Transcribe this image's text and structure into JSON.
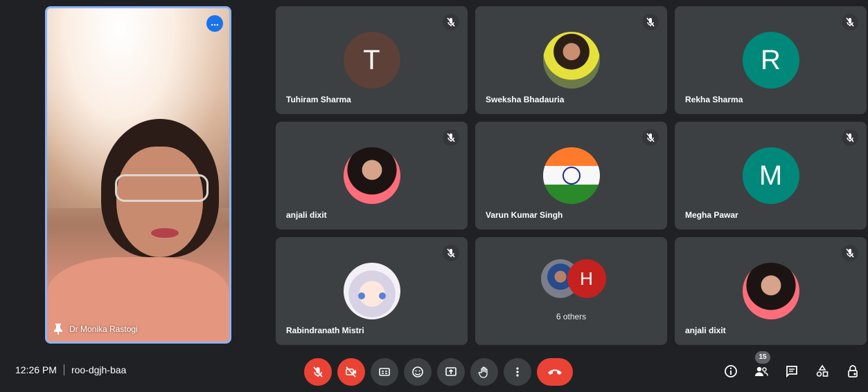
{
  "pinned": {
    "name": "Dr Monika Rastogi",
    "more_label": "..."
  },
  "tiles": [
    {
      "name": "Tuhiram Sharma",
      "avatar_letter": "T",
      "avatar_color": "#5d4037"
    },
    {
      "name": "Sweksha Bhadauria",
      "avatar_letter": "",
      "avatar_color": ""
    },
    {
      "name": "Rekha Sharma",
      "avatar_letter": "R",
      "avatar_color": "#00897b"
    },
    {
      "name": "anjali dixit",
      "avatar_letter": "",
      "avatar_color": ""
    },
    {
      "name": "Varun Kumar Singh",
      "avatar_letter": "",
      "avatar_color": ""
    },
    {
      "name": "Megha Pawar",
      "avatar_letter": "M",
      "avatar_color": "#00897b"
    },
    {
      "name": "Rabindranath Mistri",
      "avatar_letter": "",
      "avatar_color": ""
    },
    {
      "name": "anjali dixit",
      "avatar_letter": "",
      "avatar_color": ""
    }
  ],
  "others": {
    "label": "6 others",
    "avatar_letter": "H"
  },
  "meeting": {
    "time": "12:26 PM",
    "code": "roo-dgjh-baa"
  },
  "participants_count": "15",
  "colors": {
    "background": "#202124",
    "tile": "#3c4043",
    "danger": "#ea4335",
    "pinned_border": "#8ab4f8"
  }
}
